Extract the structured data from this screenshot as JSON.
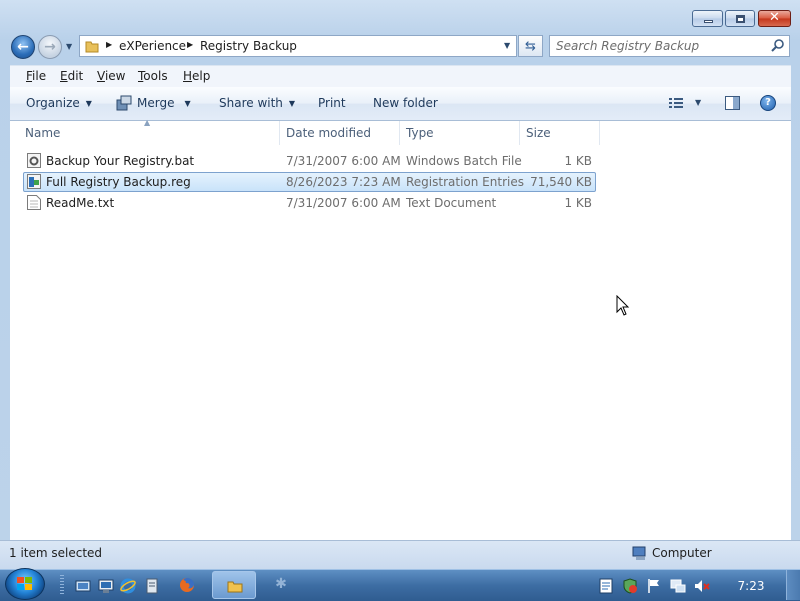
{
  "window": {
    "caption_buttons": [
      "minimize-icon",
      "maximize-icon",
      "close-icon"
    ]
  },
  "nav": {
    "breadcrumb": [
      "eXPerience",
      "Registry Backup"
    ],
    "search_placeholder": "Search Registry Backup"
  },
  "menu": [
    "File",
    "Edit",
    "View",
    "Tools",
    "Help"
  ],
  "commands": {
    "organize": "Organize",
    "merge": "Merge",
    "share_with": "Share with",
    "print": "Print",
    "new_folder": "New folder"
  },
  "columns": [
    "Name",
    "Date modified",
    "Type",
    "Size"
  ],
  "files": [
    {
      "name": "Backup Your Registry.bat",
      "date": "7/31/2007 6:00 AM",
      "type": "Windows Batch File",
      "size": "1 KB",
      "icon": "batch-file-icon",
      "selected": false
    },
    {
      "name": "Full Registry Backup.reg",
      "date": "8/26/2023 7:23 AM",
      "type": "Registration Entries",
      "size": "71,540 KB",
      "icon": "registry-file-icon",
      "selected": true
    },
    {
      "name": "ReadMe.txt",
      "date": "7/31/2007 6:00 AM",
      "type": "Text Document",
      "size": "1 KB",
      "icon": "text-file-icon",
      "selected": false
    }
  ],
  "status": {
    "selection": "1 item selected",
    "location": "Computer"
  },
  "taskbar": {
    "clock": "7:23",
    "pinned": [
      "show-desktop-icon",
      "remote-desktop-icon",
      "outlook-express-icon",
      "internet-explorer-icon",
      "firefox-icon",
      "windows-explorer-icon",
      "generic-app-icon"
    ],
    "tray": [
      "notepad-icon",
      "security-icon",
      "action-center-flag-icon",
      "network-icon",
      "volume-muted-icon"
    ]
  },
  "colors": {
    "selection_bg": "#cce4fa",
    "selection_border": "#7da2ce",
    "taskbar": "#3d6da3"
  }
}
